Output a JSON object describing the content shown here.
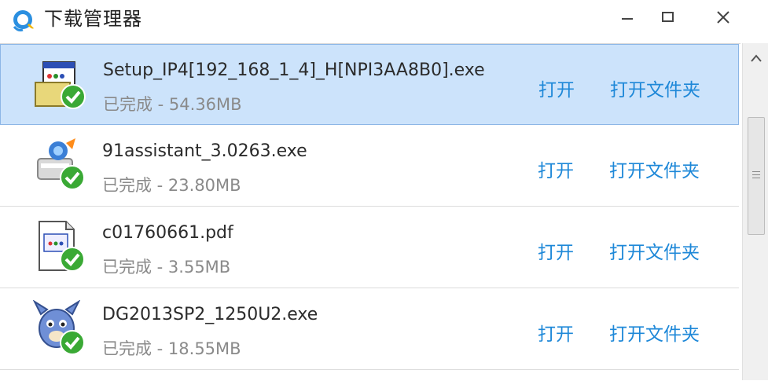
{
  "window": {
    "title": "下载管理器",
    "minimize_label": "",
    "maximize_label": "",
    "close_label": ""
  },
  "downloads": [
    {
      "name": "Setup_IP4[192_168_1_4]_H[NPI3AA8B0].exe",
      "status": "已完成 - 54.36MB",
      "open_label": "打开",
      "folder_label": "打开文件夹",
      "selected": true,
      "icon": "installer-window-icon"
    },
    {
      "name": "91assistant_3.0263.exe",
      "status": "已完成 - 23.80MB",
      "open_label": "打开",
      "folder_label": "打开文件夹",
      "selected": false,
      "icon": "assistant-app-icon"
    },
    {
      "name": "c01760661.pdf",
      "status": "已完成 - 3.55MB",
      "open_label": "打开",
      "folder_label": "打开文件夹",
      "selected": false,
      "icon": "document-icon"
    },
    {
      "name": "DG2013SP2_1250U2.exe",
      "status": "已完成 - 18.55MB",
      "open_label": "打开",
      "folder_label": "打开文件夹",
      "selected": false,
      "icon": "mascot-app-icon"
    }
  ],
  "colors": {
    "accent": "#1e88d8",
    "selected_row": "#cce3fb",
    "check_green": "#3aa935"
  }
}
